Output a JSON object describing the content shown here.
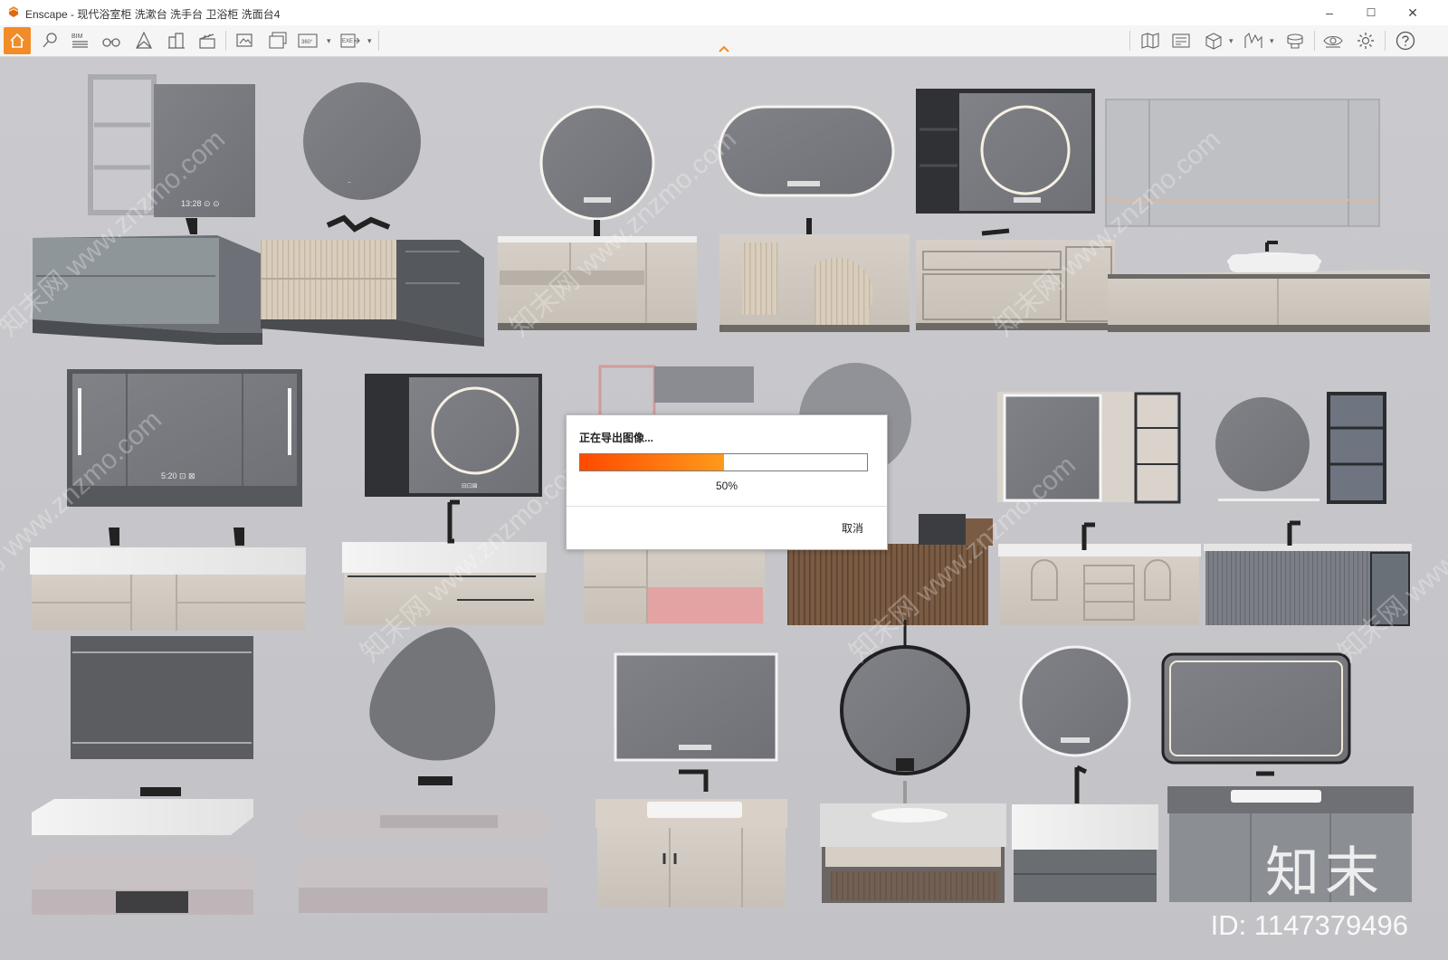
{
  "window": {
    "title": "Enscape - 现代浴室柜 洗漱台 洗手台 卫浴柜 洗面台4",
    "controls": {
      "minimize": "–",
      "maximize": "☐",
      "close": "✕"
    }
  },
  "toolbar": {
    "left_icons": [
      "home-icon",
      "pin-icon",
      "bim-icon",
      "binoculars-icon",
      "perspective-icon",
      "buildings-icon",
      "clapper-icon",
      "screenshot-icon",
      "batch-render-icon",
      "panorama-360-icon",
      "export-exe-icon"
    ],
    "right_icons": [
      "map-icon",
      "video-editor-icon",
      "asset-library-icon",
      "terrain-icon",
      "material-icon",
      "visual-settings-icon",
      "settings-icon",
      "help-icon"
    ],
    "bim_label": "BIM",
    "pano_label": "360°",
    "exe_label": "EXE"
  },
  "viewport": {
    "mirror_labels": [
      "13:28 ⊙ ⊙",
      "5:20 ⊡ ⊠",
      "⊟⊡⊠"
    ],
    "watermark": "知末网 www.znzmo.com",
    "brand": {
      "logo": "知末",
      "id": "ID: 1147379496"
    }
  },
  "dialog": {
    "title": "正在导出图像...",
    "progress": 0.5,
    "percent_label": "50%",
    "cancel_label": "取消"
  },
  "colors": {
    "accent": "#f28c28",
    "progress_start": "#ff4a00",
    "progress_end": "#ff9a1a"
  }
}
